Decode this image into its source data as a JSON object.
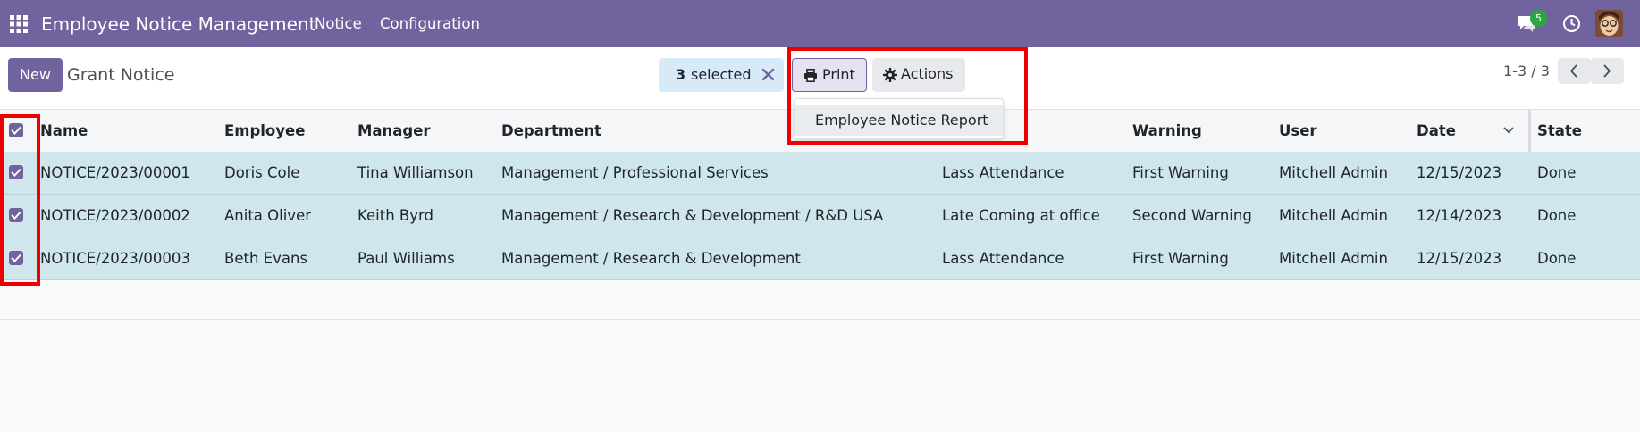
{
  "navbar": {
    "app_title": "Employee Notice Management",
    "menu": [
      "Notice",
      "Configuration"
    ],
    "chat_badge": "5"
  },
  "control_panel": {
    "new_label": "New",
    "breadcrumb": "Grant Notice",
    "selected_count": "3",
    "selected_label": "selected",
    "print_label": "Print",
    "actions_label": "Actions",
    "pager": "1-3 / 3"
  },
  "dropdown": {
    "items": [
      "Employee Notice Report"
    ]
  },
  "table": {
    "headers": [
      "Name",
      "Employee",
      "Manager",
      "Department",
      "Warning",
      "User",
      "Date",
      "State"
    ],
    "rows": [
      {
        "name": "NOTICE/2023/00001",
        "employee": "Doris Cole",
        "manager": "Tina Williamson",
        "department": "Management / Professional Services",
        "reason": "Lass Attendance",
        "warning": "First Warning",
        "user": "Mitchell Admin",
        "date": "12/15/2023",
        "state": "Done"
      },
      {
        "name": "NOTICE/2023/00002",
        "employee": "Anita Oliver",
        "manager": "Keith Byrd",
        "department": "Management / Research & Development / R&D USA",
        "reason": "Late Coming at office",
        "warning": "Second Warning",
        "user": "Mitchell Admin",
        "date": "12/14/2023",
        "state": "Done"
      },
      {
        "name": "NOTICE/2023/00003",
        "employee": "Beth Evans",
        "manager": "Paul Williams",
        "department": "Management / Research & Development",
        "reason": "Lass Attendance",
        "warning": "First Warning",
        "user": "Mitchell Admin",
        "date": "12/15/2023",
        "state": "Done"
      }
    ]
  },
  "colors": {
    "brand": "#71639e",
    "selected_row": "#cfe7ec",
    "highlight": "#ee0000",
    "badge": "#28a745"
  },
  "icons": [
    "apps-grid-icon",
    "chat-icon",
    "clock-icon",
    "avatar",
    "close-icon",
    "print-icon",
    "gear-icon",
    "chevron-left-icon",
    "chevron-right-icon",
    "sort-chevron-icon",
    "checkbox-checked-icon"
  ]
}
